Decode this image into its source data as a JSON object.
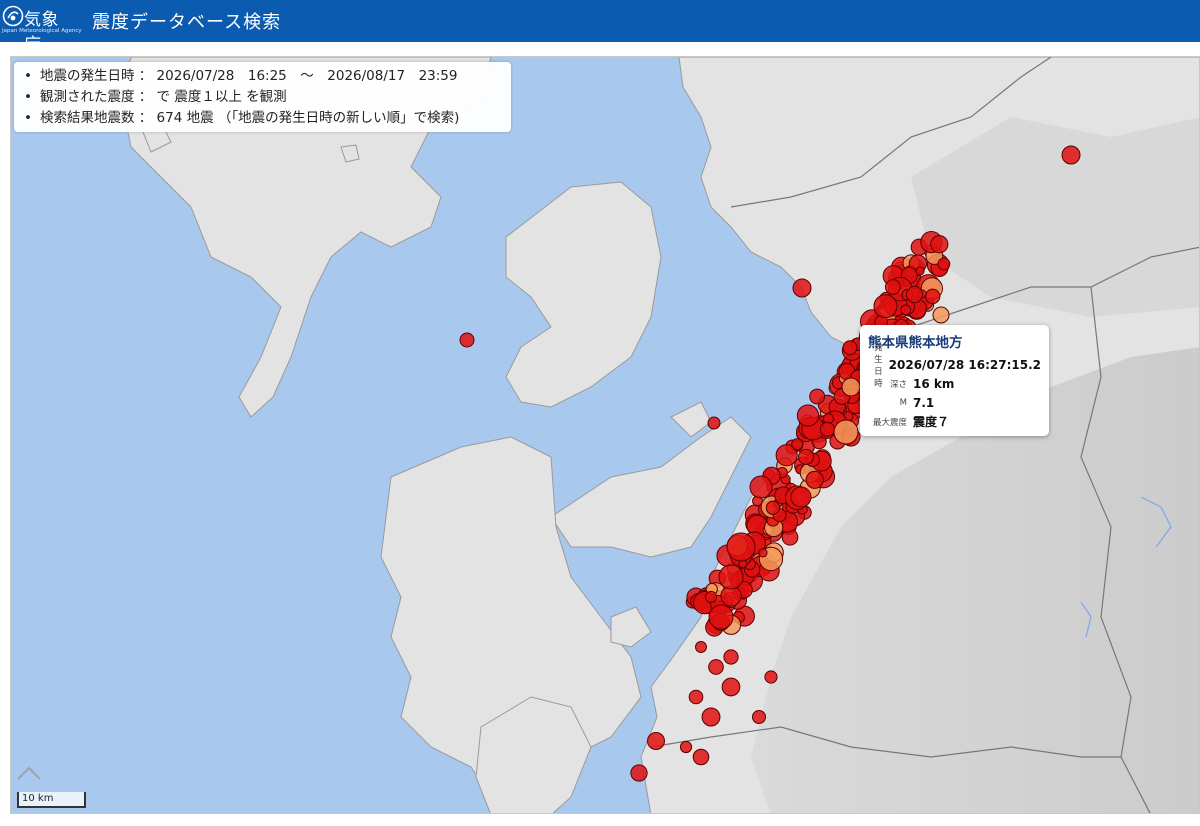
{
  "header": {
    "logo_text": "気象庁",
    "logo_subtext": "Japan Meteorological Agency",
    "title": "震度データベース検索"
  },
  "info": {
    "items": [
      "地震の発生日時 ： 2026/07/28　16:25　～　2026/08/17　23:59",
      "観測された震度 ： で 震度１以上 を観測",
      "検索結果地震数 ： 674 地震 （「地震の発生日時の新しい順」で検索)"
    ]
  },
  "popup": {
    "title": "熊本県熊本地方",
    "rows": [
      {
        "label": "発生日時",
        "value": "2026/07/28 16:27:15.2"
      },
      {
        "label": "深さ",
        "value": "16 km"
      },
      {
        "label": "M",
        "value": "7.1"
      },
      {
        "label": "最大震度",
        "value": "震度７"
      }
    ]
  },
  "map": {
    "scale_label": "10 km",
    "colors": {
      "sea": "#a9c8ee",
      "land": "#e6e6e6",
      "mountain": "#cfcfcf",
      "quake_fill": "#e01010",
      "quake_orange": "#f39a5a",
      "quake_edge": "#5a0000"
    },
    "icons": [
      "jma-logo-icon",
      "zoom-up-icon"
    ]
  }
}
